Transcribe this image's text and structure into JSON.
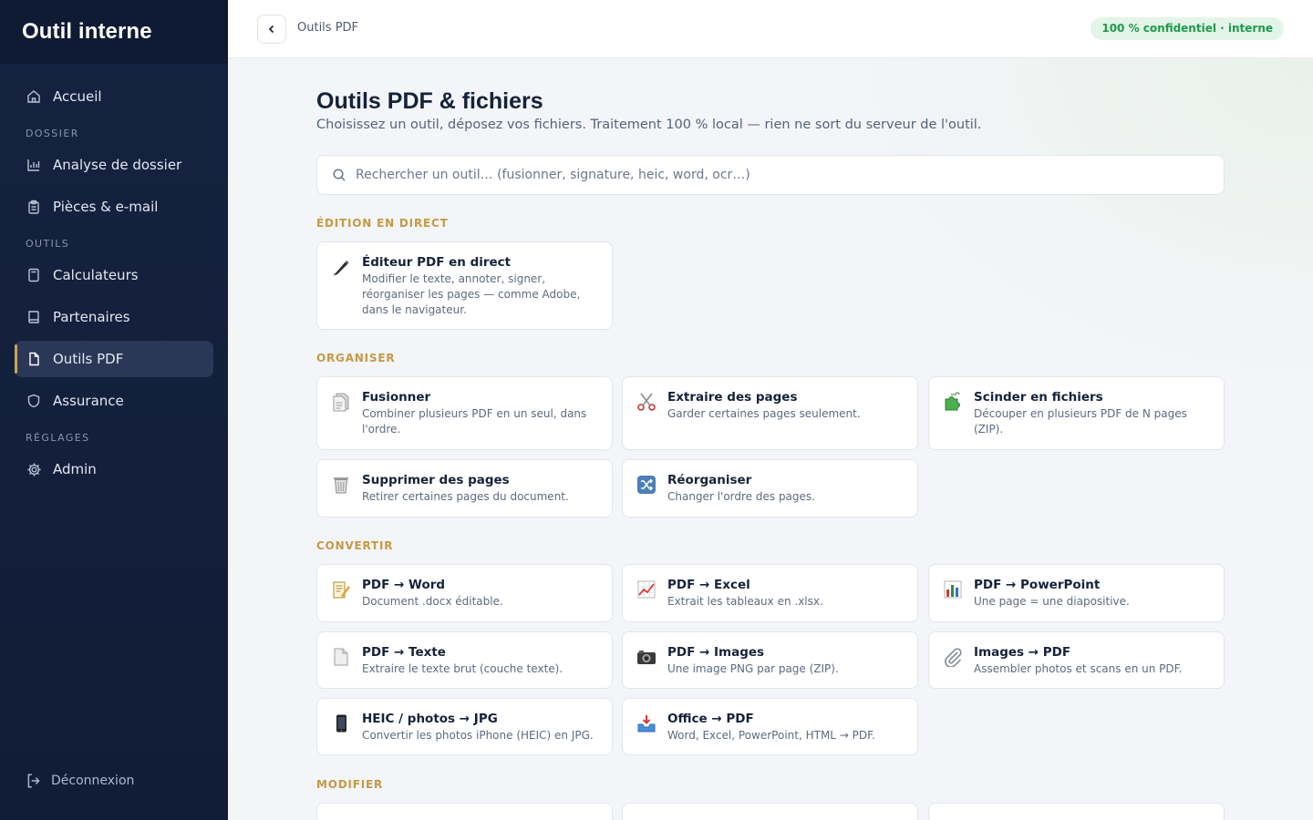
{
  "app": {
    "brand": "Outil interne"
  },
  "sidebar": {
    "items": [
      {
        "label": "Accueil"
      },
      {
        "section": "DOSSIER"
      },
      {
        "label": "Analyse de dossier"
      },
      {
        "label": "Pièces & e-mail"
      },
      {
        "section": "OUTILS"
      },
      {
        "label": "Calculateurs"
      },
      {
        "label": "Partenaires"
      },
      {
        "label": "Outils PDF",
        "active": true
      },
      {
        "label": "Assurance"
      },
      {
        "section": "RÉGLAGES"
      },
      {
        "label": "Admin"
      }
    ],
    "logout": "Déconnexion"
  },
  "topbar": {
    "breadcrumb": "Outils PDF",
    "badge": "100 % confidentiel · interne"
  },
  "page": {
    "title": "Outils PDF & fichiers",
    "subtitle": "Choisissez un outil, déposez vos fichiers. Traitement 100 % local — rien ne sort du serveur de l'outil."
  },
  "search": {
    "placeholder": "Rechercher un outil… (fusionner, signature, heic, word, ocr…)"
  },
  "sections": [
    {
      "label": "ÉDITION EN DIRECT",
      "tools": [
        {
          "icon": "pen-icon",
          "title": "Éditeur PDF en direct",
          "desc": "Modifier le texte, annoter, signer, réorganiser les pages — comme Adobe, dans le navigateur."
        }
      ]
    },
    {
      "label": "ORGANISER",
      "tools": [
        {
          "icon": "file-stack-icon",
          "title": "Fusionner",
          "desc": "Combiner plusieurs PDF en un seul, dans l'ordre."
        },
        {
          "icon": "scissors-icon",
          "title": "Extraire des pages",
          "desc": "Garder certaines pages seulement."
        },
        {
          "icon": "puzzle-icon",
          "title": "Scinder en fichiers",
          "desc": "Découper en plusieurs PDF de N pages (ZIP)."
        },
        {
          "icon": "wastebasket-icon",
          "title": "Supprimer des pages",
          "desc": "Retirer certaines pages du document."
        },
        {
          "icon": "shuffle-icon",
          "title": "Réorganiser",
          "desc": "Changer l'ordre des pages."
        }
      ]
    },
    {
      "label": "CONVERTIR",
      "tools": [
        {
          "icon": "memo-icon",
          "title": "PDF → Word",
          "desc": "Document .docx éditable."
        },
        {
          "icon": "chart-up-icon",
          "title": "PDF → Excel",
          "desc": "Extrait les tableaux en .xlsx."
        },
        {
          "icon": "bar-chart-icon",
          "title": "PDF → PowerPoint",
          "desc": "Une page = une diapositive."
        },
        {
          "icon": "page-icon",
          "title": "PDF → Texte",
          "desc": "Extraire le texte brut (couche texte)."
        },
        {
          "icon": "camera-icon",
          "title": "PDF → Images",
          "desc": "Une image PNG par page (ZIP)."
        },
        {
          "icon": "paperclip-icon",
          "title": "Images → PDF",
          "desc": "Assembler photos et scans en un PDF."
        },
        {
          "icon": "phone-icon",
          "title": "HEIC / photos → JPG",
          "desc": "Convertir les photos iPhone (HEIC) en JPG."
        },
        {
          "icon": "inbox-icon",
          "title": "Office → PDF",
          "desc": "Word, Excel, PowerPoint, HTML → PDF."
        }
      ]
    },
    {
      "label": "MODIFIER",
      "tools": []
    }
  ]
}
